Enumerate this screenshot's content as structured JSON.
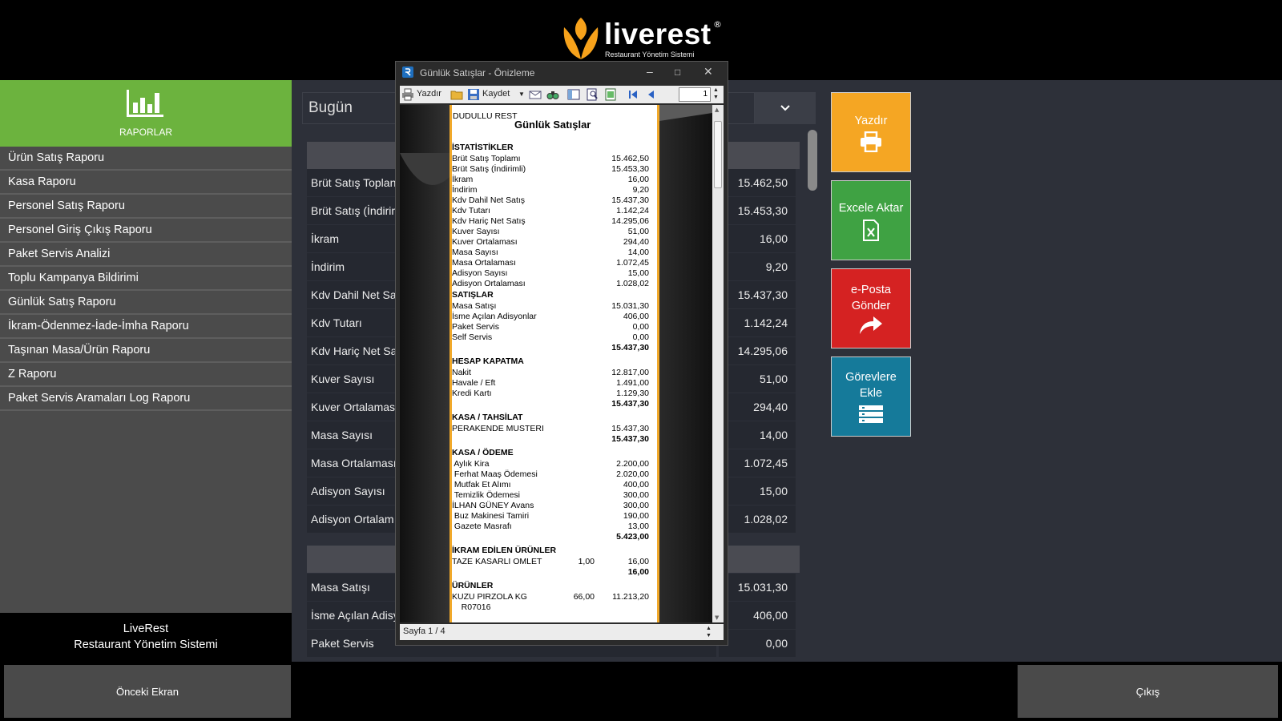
{
  "logo": {
    "name": "liverest",
    "reg": "®",
    "subtitle": "Restaurant Yönetim Sistemi",
    "color": "#f7a21b"
  },
  "sidebar": {
    "header_label": "RAPORLAR",
    "accent": "#6cb33e",
    "items": [
      {
        "label": "Ürün Satış Raporu"
      },
      {
        "label": "Kasa Raporu"
      },
      {
        "label": "Personel Satış Raporu"
      },
      {
        "label": "Personel Giriş Çıkış Raporu"
      },
      {
        "label": "Paket Servis Analizi"
      },
      {
        "label": "Toplu Kampanya Bildirimi"
      },
      {
        "label": "Günlük Satış Raporu"
      },
      {
        "label": "İkram-Ödenmez-İade-İmha Raporu"
      },
      {
        "label": "Taşınan Masa/Ürün Raporu"
      },
      {
        "label": "Z Raporu"
      },
      {
        "label": "Paket Servis Aramaları Log Raporu"
      }
    ],
    "brand_line1": "LiveRest",
    "brand_line2": "Restaurant Yönetim Sistemi"
  },
  "footer": {
    "prev_label": "Önceki Ekran",
    "exit_label": "Çıkış"
  },
  "period": {
    "selected": "Bugün"
  },
  "stats": [
    {
      "label": "Brüt Satış Toplan",
      "value": "15.462,50"
    },
    {
      "label": "Brüt Satış (İndirim",
      "value": "15.453,30"
    },
    {
      "label": "İkram",
      "value": "16,00"
    },
    {
      "label": "İndirim",
      "value": "9,20"
    },
    {
      "label": "Kdv Dahil Net Sa",
      "value": "15.437,30"
    },
    {
      "label": "Kdv Tutarı",
      "value": "1.142,24"
    },
    {
      "label": "Kdv Hariç Net Sa",
      "value": "14.295,06"
    },
    {
      "label": "Kuver Sayısı",
      "value": "51,00"
    },
    {
      "label": "Kuver Ortalaması",
      "value": "294,40"
    },
    {
      "label": "Masa Sayısı",
      "value": "14,00"
    },
    {
      "label": "Masa Ortalaması",
      "value": "1.072,45"
    },
    {
      "label": "Adisyon Sayısı",
      "value": "15,00"
    },
    {
      "label": "Adisyon Ortalam",
      "value": "1.028,02"
    }
  ],
  "sales": [
    {
      "label": "Masa Satışı",
      "value": "15.031,30"
    },
    {
      "label": "İsme Açılan Adisy",
      "value": "406,00"
    },
    {
      "label": "Paket Servis",
      "value": "0,00"
    }
  ],
  "actions": [
    {
      "label": "Yazdır",
      "color": "#f5a623",
      "icon": "printer-icon"
    },
    {
      "label": "Excele Aktar",
      "color": "#3fa243",
      "icon": "excel-icon"
    },
    {
      "label": "e-Posta Gönder",
      "color": "#d52222",
      "icon": "share-arrow-icon"
    },
    {
      "label": "Görevlere Ekle",
      "color": "#157a9a",
      "icon": "tasks-icon"
    }
  ],
  "preview": {
    "title": "Günlük Satışlar - Önizleme",
    "toolbar": {
      "print": "Yazdır",
      "save": "Kaydet",
      "page_input": "1"
    },
    "status": "Sayfa 1 / 4",
    "report": {
      "company": "DUDULLU REST",
      "title": "Günlük Satışlar",
      "lines": [
        {
          "type": "h",
          "text": "İSTATİSTİKLER"
        },
        {
          "type": "kv",
          "k": "Brüt Satış Toplamı",
          "v": "15.462,50"
        },
        {
          "type": "kv",
          "k": "Brüt Satış (İndirimli)",
          "v": "15.453,30"
        },
        {
          "type": "kv",
          "k": "İkram",
          "v": "16,00"
        },
        {
          "type": "kv",
          "k": "İndirim",
          "v": "9,20"
        },
        {
          "type": "kv",
          "k": "Kdv Dahil Net Satış",
          "v": "15.437,30"
        },
        {
          "type": "kv",
          "k": "Kdv Tutarı",
          "v": "1.142,24"
        },
        {
          "type": "kv",
          "k": "Kdv Hariç Net Satış",
          "v": "14.295,06"
        },
        {
          "type": "kv",
          "k": "Kuver Sayısı",
          "v": "51,00"
        },
        {
          "type": "kv",
          "k": "Kuver Ortalaması",
          "v": "294,40"
        },
        {
          "type": "kv",
          "k": "Masa Sayısı",
          "v": "14,00"
        },
        {
          "type": "kv",
          "k": "Masa Ortalaması",
          "v": "1.072,45"
        },
        {
          "type": "kv",
          "k": "Adisyon Sayısı",
          "v": "15,00"
        },
        {
          "type": "kv",
          "k": "Adisyon Ortalaması",
          "v": "1.028,02"
        },
        {
          "type": "h",
          "text": "SATIŞLAR"
        },
        {
          "type": "kv",
          "k": "Masa Satışı",
          "v": "15.031,30"
        },
        {
          "type": "kv",
          "k": "İsme Açılan Adisyonlar",
          "v": "406,00"
        },
        {
          "type": "kv",
          "k": "Paket Servis",
          "v": "0,00"
        },
        {
          "type": "kv",
          "k": "Self Servis",
          "v": "0,00"
        },
        {
          "type": "total",
          "v": "15.437,30"
        },
        {
          "type": "gap"
        },
        {
          "type": "h",
          "text": "HESAP KAPATMA"
        },
        {
          "type": "kv",
          "k": "Nakit",
          "v": "12.817,00"
        },
        {
          "type": "kv",
          "k": "Havale / Eft",
          "v": "1.491,00"
        },
        {
          "type": "kv",
          "k": "Kredi Kartı",
          "v": "1.129,30"
        },
        {
          "type": "total",
          "v": "15.437,30"
        },
        {
          "type": "gap"
        },
        {
          "type": "h",
          "text": "KASA / TAHSİLAT"
        },
        {
          "type": "kv",
          "k": "PERAKENDE MUSTERI",
          "v": "15.437,30"
        },
        {
          "type": "total",
          "v": "15.437,30"
        },
        {
          "type": "gap"
        },
        {
          "type": "h",
          "text": "KASA / ÖDEME"
        },
        {
          "type": "kv",
          "k": " Aylık Kira",
          "v": "2.200,00"
        },
        {
          "type": "kv",
          "k": " Ferhat Maaş Ödemesi",
          "v": "2.020,00"
        },
        {
          "type": "kv",
          "k": " Mutfak Et Alımı",
          "v": "400,00"
        },
        {
          "type": "kv",
          "k": " Temizlik Ödemesi",
          "v": "300,00"
        },
        {
          "type": "kv",
          "k": "İLHAN GÜNEY Avans",
          "v": "300,00"
        },
        {
          "type": "kv",
          "k": " Buz Makinesi Tamiri",
          "v": "190,00"
        },
        {
          "type": "kv",
          "k": " Gazete Masrafı",
          "v": "13,00"
        },
        {
          "type": "total",
          "v": "5.423,00"
        },
        {
          "type": "gap"
        },
        {
          "type": "h",
          "text": "İKRAM EDİLEN ÜRÜNLER"
        },
        {
          "type": "kqv",
          "k": "TAZE KASARLI OMLET",
          "q": "1,00",
          "v": "16,00"
        },
        {
          "type": "total",
          "v": "16,00"
        },
        {
          "type": "gap"
        },
        {
          "type": "h",
          "text": "ÜRÜNLER"
        },
        {
          "type": "kqv",
          "k": "KUZU PIRZOLA KG",
          "q": "66,00",
          "v": "11.213,20"
        },
        {
          "type": "kv",
          "k": "    R07016",
          "v": ""
        }
      ]
    }
  }
}
